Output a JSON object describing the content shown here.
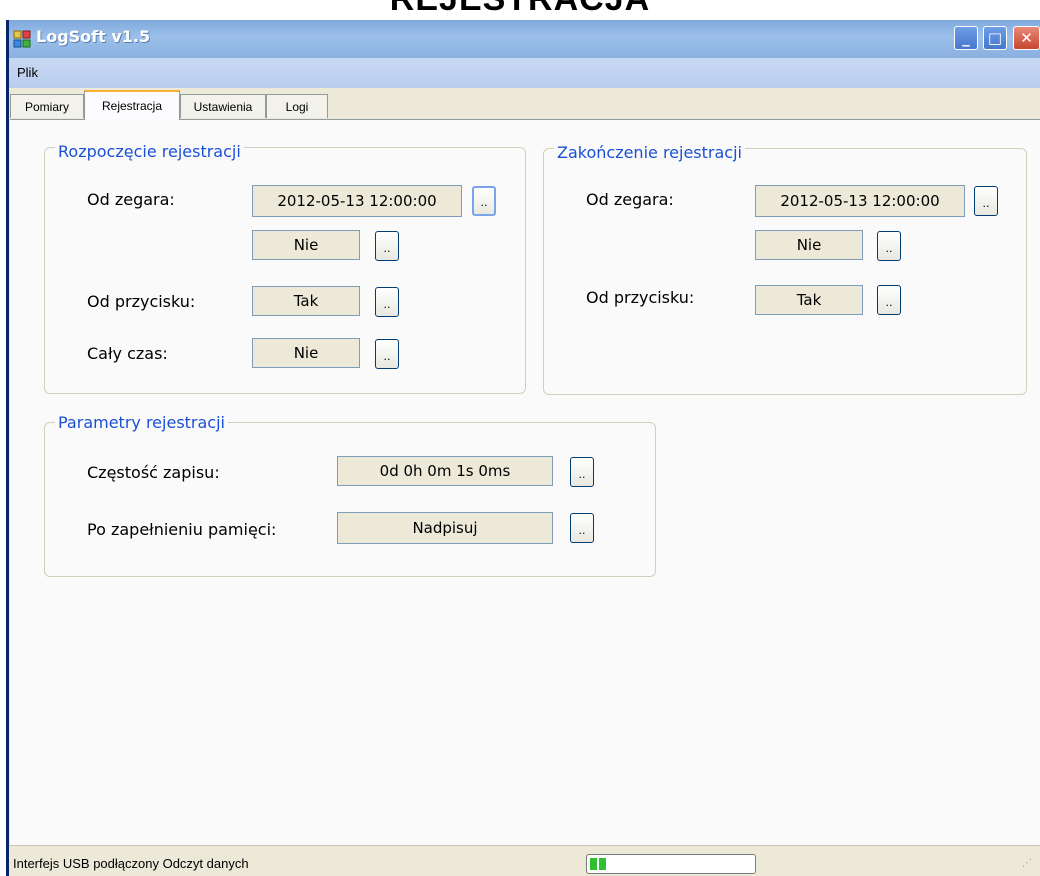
{
  "window": {
    "title": "LogSoft v1.5",
    "heading_partial": "REJESTRACJA",
    "minimize_label": "_",
    "maximize_label": "□",
    "close_label": "✕"
  },
  "menu": {
    "items": [
      "Plik"
    ]
  },
  "tabs": [
    "Pomiary",
    "Rejestracja",
    "Ustawienia",
    "Logi"
  ],
  "active_tab": "Rejestracja",
  "start_group": {
    "title": "Rozpoczęcie rejestracji",
    "clock_label": "Od zegara:",
    "clock_value": "2012-05-13 12:00:00",
    "clock_enabled": "Nie",
    "button_label": "Od przycisku:",
    "button_value": "Tak",
    "always_label": "Cały czas:",
    "always_value": "Nie"
  },
  "end_group": {
    "title": "Zakończenie rejestracji",
    "clock_label": "Od zegara:",
    "clock_value": "2012-05-13 12:00:00",
    "clock_enabled": "Nie",
    "button_label": "Od przycisku:",
    "button_value": "Tak"
  },
  "params_group": {
    "title": "Parametry rejestracji",
    "frequency_label": "Częstość zapisu:",
    "frequency_value": "0d 0h 0m 1s 0ms",
    "memory_label": "Po zapełnieniu pamięci:",
    "memory_value": "Nadpisuj"
  },
  "dots_label": "..",
  "status": {
    "text": "Interfejs USB podłączony  Odczyt danych",
    "progress_blocks": 2,
    "progress_color": "#2ec02e"
  },
  "colors": {
    "group_title": "#1b4fd6",
    "titlebar": "#8bb0e0",
    "value_box": "#ece9d8"
  }
}
